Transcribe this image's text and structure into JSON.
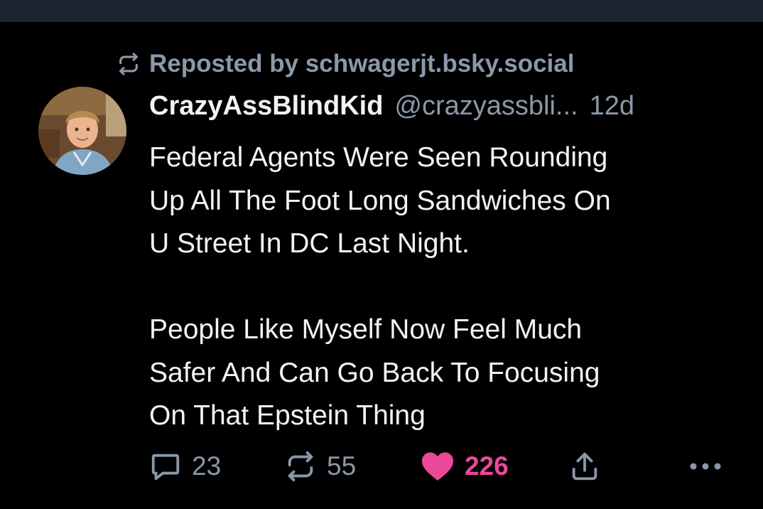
{
  "repost": {
    "label": "Reposted by schwagerjt.bsky.social",
    "icon": "repost-icon"
  },
  "author": {
    "display_name": "CrazyAssBlindKid",
    "handle": "@crazyassbli...",
    "time": "12d",
    "avatar_icon": "avatar-photo"
  },
  "post": {
    "lines_para1": [
      "Federal Agents Were Seen Rounding",
      "Up All The Foot Long Sandwiches On",
      "U Street In DC Last Night."
    ],
    "lines_para2": [
      "People Like Myself Now Feel Much",
      "Safer And Can Go Back To Focusing",
      "On That Epstein Thing"
    ]
  },
  "actions": {
    "reply_count": "23",
    "repost_count": "55",
    "like_count": "226",
    "reply_icon": "reply-icon",
    "repost_icon": "repost-icon",
    "like_icon": "heart-icon",
    "share_icon": "share-icon",
    "more_icon": "more-icon"
  },
  "colors": {
    "background": "#000000",
    "topbar": "#1b2430",
    "text": "#f1f3f5",
    "muted": "#8b98a9",
    "like": "#ec4899"
  }
}
